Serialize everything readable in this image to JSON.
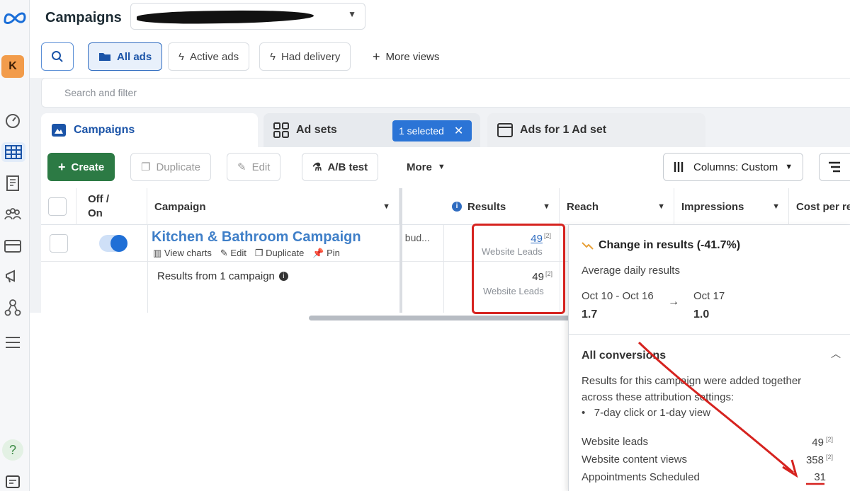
{
  "header": {
    "title": "Campaigns"
  },
  "views": {
    "all_ads": "All ads",
    "active_ads": "Active ads",
    "had_delivery": "Had delivery",
    "more_views": "More views"
  },
  "search": {
    "placeholder": "Search and filter"
  },
  "tabs": [
    {
      "label": "Campaigns"
    },
    {
      "label": "Ad sets",
      "chip": "1 selected"
    },
    {
      "label": "Ads for 1 Ad set"
    }
  ],
  "toolbar": {
    "create": "Create",
    "duplicate": "Duplicate",
    "edit": "Edit",
    "ab_test": "A/B test",
    "more": "More",
    "columns": "Columns: Custom"
  },
  "table": {
    "headers": {
      "toggle": "Off / On",
      "campaign": "Campaign",
      "results": "Results",
      "reach": "Reach",
      "impressions": "Impressions",
      "cost": "Cost per re"
    },
    "row": {
      "name": "Kitchen & Bathroom Campaign",
      "actions": [
        "View charts",
        "Edit",
        "Duplicate",
        "Pin"
      ],
      "budget_fragment": "t bud...",
      "results_value": "49",
      "results_note": "[2]",
      "results_label": "Website Leads"
    },
    "summary": {
      "label": "Results from 1 campaign",
      "results_value": "49",
      "results_note": "[2]",
      "results_label": "Website Leads"
    }
  },
  "popover": {
    "title": "Change in results (-41.7%)",
    "subtitle": "Average daily results",
    "from_period": "Oct 10 - Oct 16",
    "from_value": "1.7",
    "to_period": "Oct 17",
    "to_value": "1.0",
    "conversions_title": "All conversions",
    "description_1": "Results for this campaign were added together",
    "description_2": "across these attribution settings:",
    "attribution": "7-day click or 1-day view",
    "rows": [
      {
        "label": "Website leads",
        "value": "49",
        "note": "[2]"
      },
      {
        "label": "Website content views",
        "value": "358",
        "note": "[2]"
      },
      {
        "label": "Appointments Scheduled",
        "value": "31",
        "note": ""
      }
    ]
  },
  "colors": {
    "brand_blue": "#1b54a8",
    "create_green": "#2c7a44",
    "annotation_red": "#d6231f"
  }
}
